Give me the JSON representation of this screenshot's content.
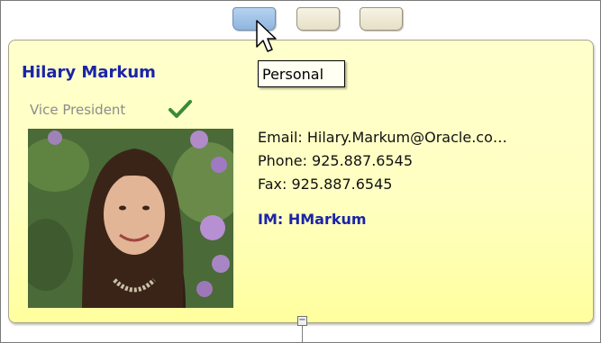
{
  "tabs": [
    {
      "name": "personal-tab",
      "active": true
    },
    {
      "name": "tab-2",
      "active": false
    },
    {
      "name": "tab-3",
      "active": false
    }
  ],
  "tooltip": "Personal",
  "card": {
    "name": "Hilary Markum",
    "title": "Vice President",
    "email": "Email: Hilary.Markum@Oracle.co…",
    "phone": "Phone: 925.887.6545",
    "fax": "Fax: 925.887.6545",
    "im": "IM: HMarkum"
  },
  "collapse_symbol": "−",
  "colors": {
    "name": "#1a24a8",
    "check": "#3b8a3b",
    "active_tab": "#9cc0e6"
  }
}
